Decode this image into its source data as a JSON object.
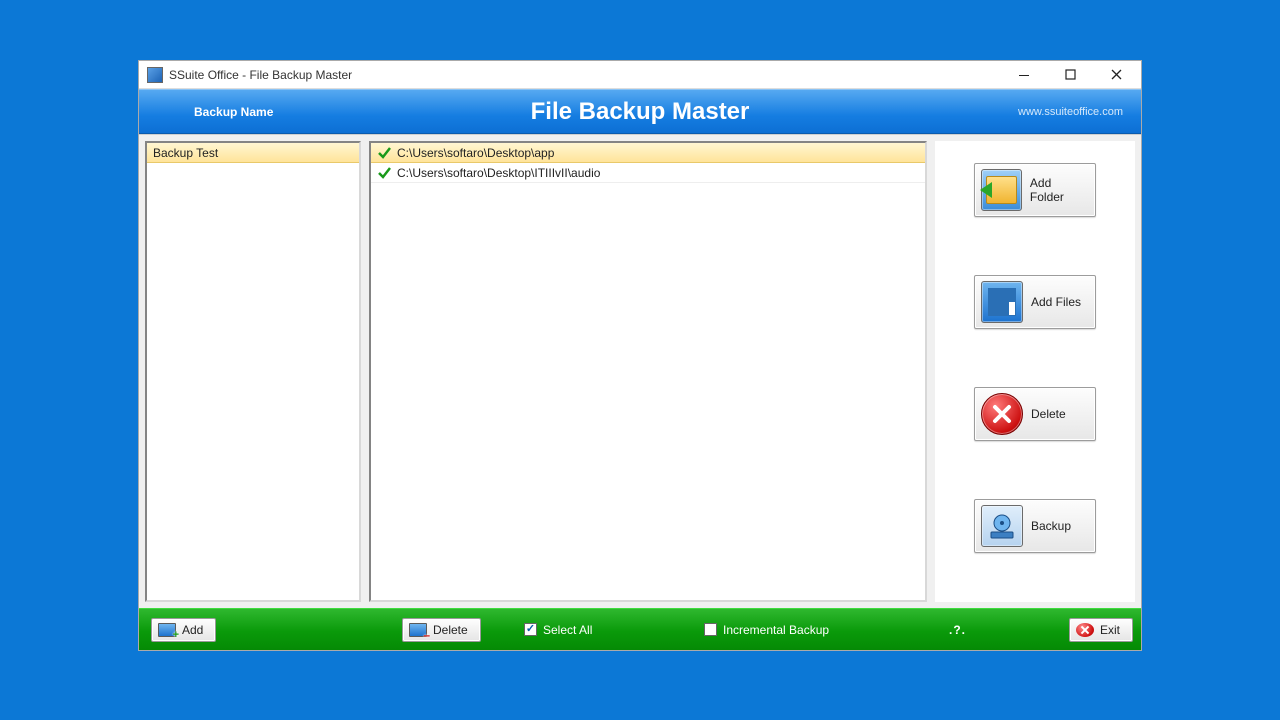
{
  "window": {
    "title": "SSuite Office - File Backup Master"
  },
  "header": {
    "backup_name_label": "Backup Name",
    "title": "File Backup Master",
    "site_link": "www.ssuiteoffice.com"
  },
  "backups": {
    "items": [
      {
        "name": "Backup Test",
        "selected": true
      }
    ]
  },
  "files": {
    "items": [
      {
        "path": "C:\\Users\\softaro\\Desktop\\app",
        "checked": true,
        "selected": true
      },
      {
        "path": "C:\\Users\\softaro\\Desktop\\ITIIIvII\\audio",
        "checked": true,
        "selected": false
      }
    ]
  },
  "side_buttons": {
    "add_folder": "Add Folder",
    "add_files": "Add Files",
    "delete": "Delete",
    "backup": "Backup"
  },
  "bottombar": {
    "add": "Add",
    "delete": "Delete",
    "select_all": {
      "label": "Select All",
      "checked": true
    },
    "incremental": {
      "label": "Incremental Backup",
      "checked": false
    },
    "help": ".?.",
    "exit": "Exit"
  }
}
